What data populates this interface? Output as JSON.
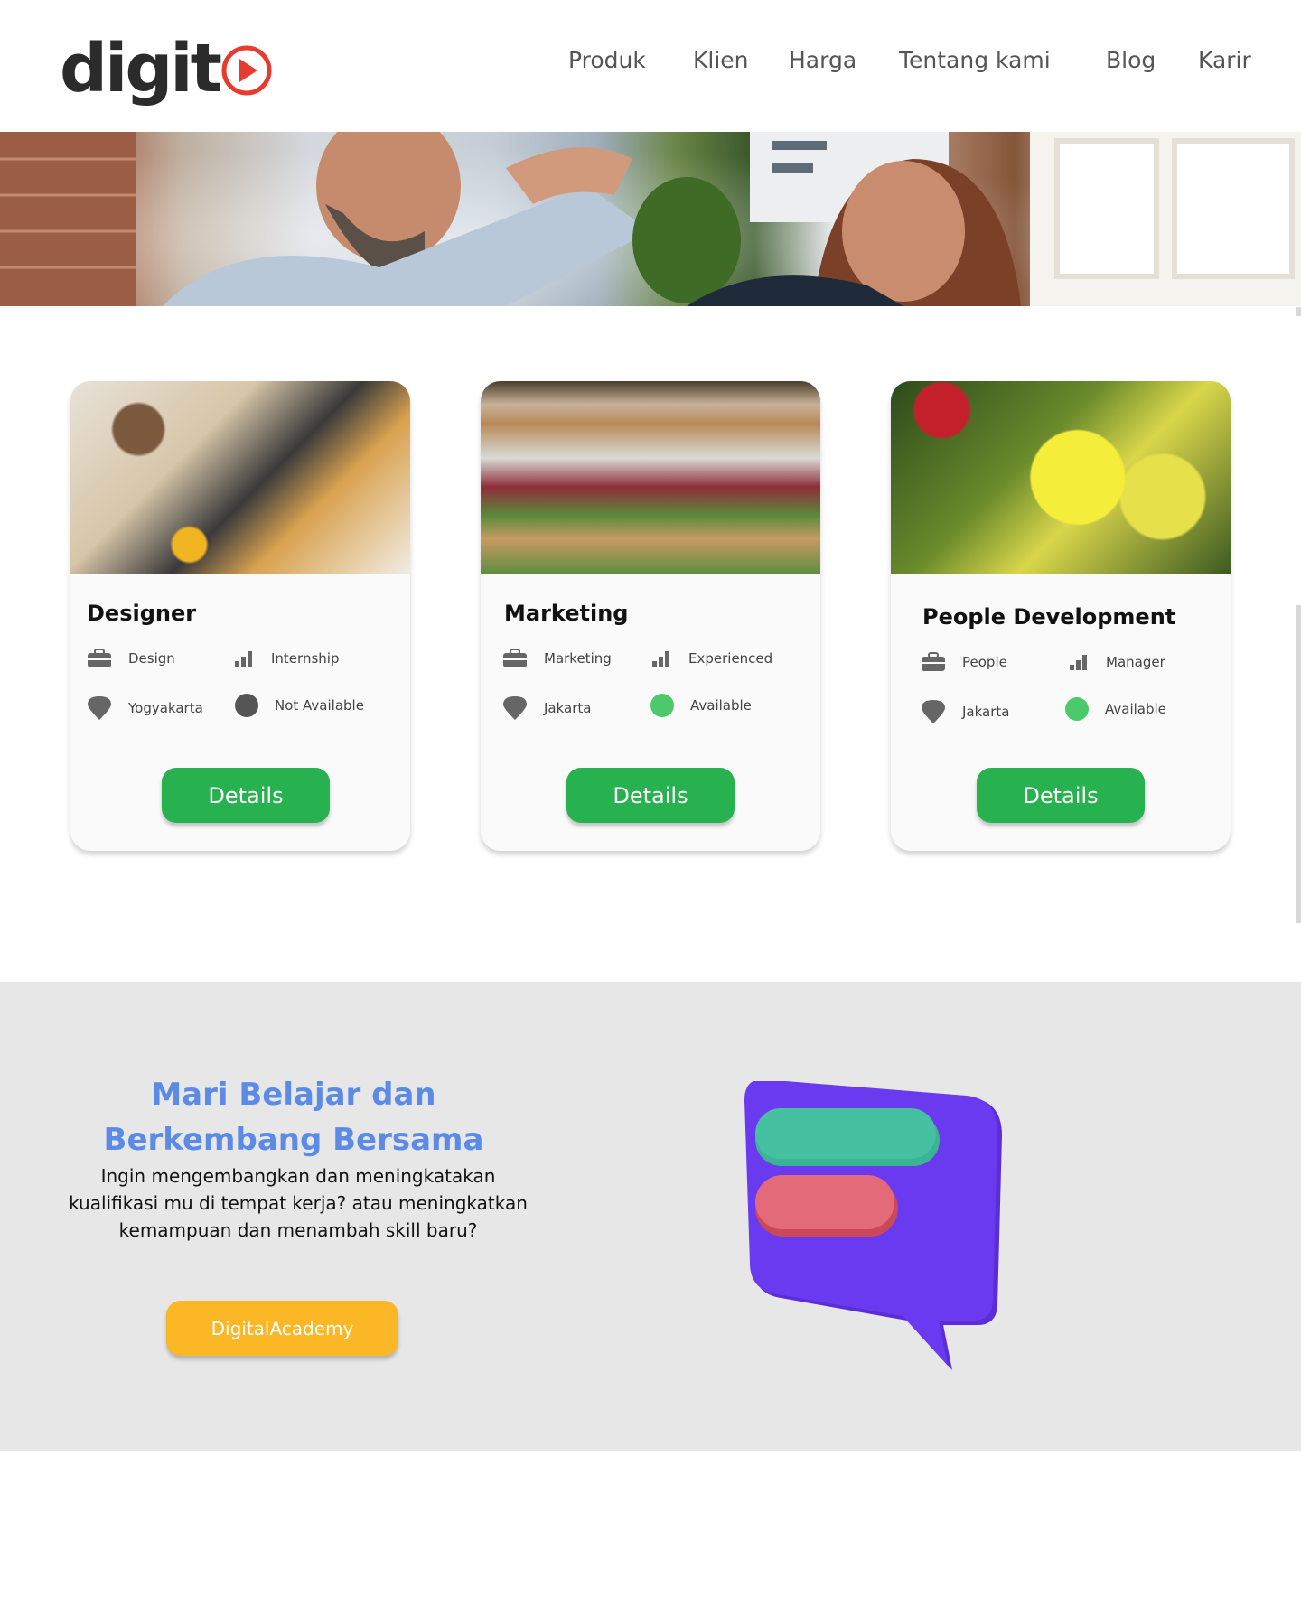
{
  "header": {
    "logo_text": "digit",
    "nav": [
      {
        "label": "Produk"
      },
      {
        "label": "Klien"
      },
      {
        "label": "Harga"
      },
      {
        "label": "Tentang kami"
      },
      {
        "label": "Blog"
      },
      {
        "label": "Karir"
      }
    ]
  },
  "jobs": [
    {
      "title": "Designer",
      "department": "Design",
      "level": "Internship",
      "location": "Yogyakarta",
      "status": "Not Available",
      "status_color": "#555555",
      "button": "Details"
    },
    {
      "title": "Marketing",
      "department": "Marketing",
      "level": "Experienced",
      "location": "Jakarta",
      "status": "Available",
      "status_color": "#4cc96a",
      "button": "Details"
    },
    {
      "title": "People Development",
      "department": "People",
      "level": "Manager",
      "location": "Jakarta",
      "status": "Available",
      "status_color": "#4cc96a",
      "button": "Details"
    }
  ],
  "promo": {
    "title_line1": "Mari Belajar dan",
    "title_line2": "Berkembang Bersama",
    "text_line1": "Ingin mengembangkan dan meningkatakan",
    "text_line2": "kualifikasi mu di tempat kerja? atau meningkatkan",
    "text_line3": "kemampuan dan menambah skill baru?",
    "button": "DigitalAcademy"
  },
  "colors": {
    "accent_blue": "#5c8be6",
    "button_green": "#27b24f",
    "button_yellow": "#fbb726",
    "logo_red": "#e63b2e"
  },
  "icons": [
    "briefcase-icon",
    "bar-chart-icon",
    "location-pin-icon",
    "status-dot-icon",
    "play-logo-icon",
    "chat-bubble-illustration"
  ]
}
